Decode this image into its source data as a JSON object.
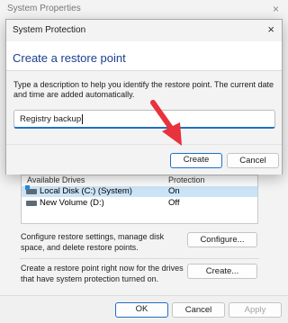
{
  "background_window": {
    "title": "System Properties",
    "close_glyph": "×",
    "table": {
      "headers": [
        "Available Drives",
        "Protection"
      ],
      "rows": [
        {
          "name": "Local Disk (C:) (System)",
          "protection": "On",
          "selected": true
        },
        {
          "name": "New Volume (D:)",
          "protection": "Off",
          "selected": false
        }
      ]
    },
    "configure_text": "Configure restore settings, manage disk space, and delete restore points.",
    "configure_button": "Configure...",
    "create_text": "Create a restore point right now for the drives that have system protection turned on.",
    "create_button": "Create...",
    "footer_buttons": {
      "ok": "OK",
      "cancel": "Cancel",
      "apply": "Apply"
    }
  },
  "dialog": {
    "title": "System Protection",
    "close_glyph": "×",
    "heading": "Create a restore point",
    "description": "Type a description to help you identify the restore point. The current date and time are added automatically.",
    "input_value": "Registry backup",
    "create_button": "Create",
    "cancel_button": "Cancel"
  },
  "colors": {
    "heading": "#1a3f8f",
    "accent": "#1f6fc5",
    "pointer_arrow": "#e8323c"
  }
}
